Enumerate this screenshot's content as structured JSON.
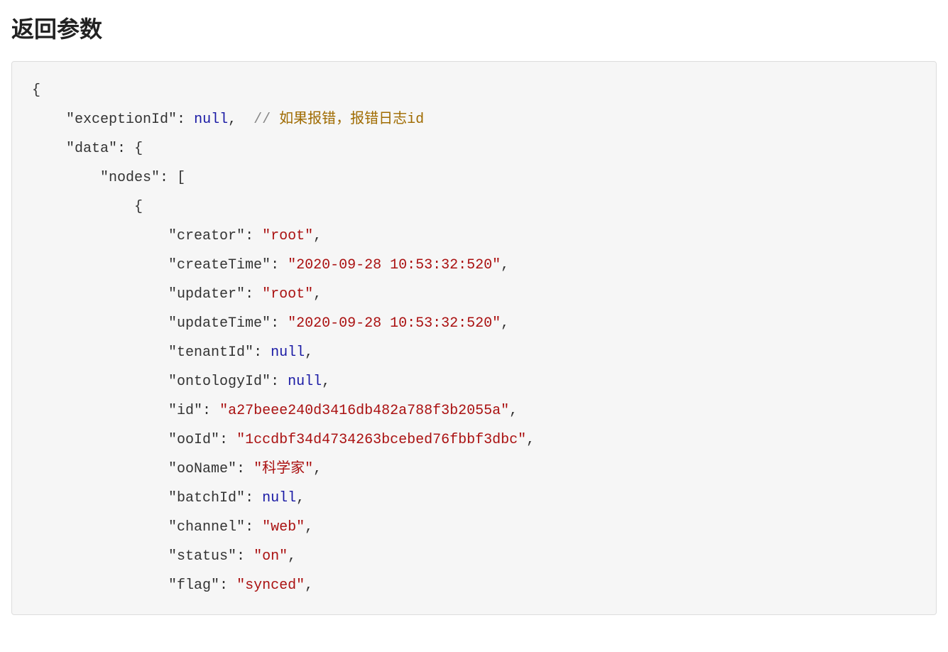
{
  "heading": "返回参数",
  "comment_slashes": "//",
  "comment_text": "如果报错，报错日志id",
  "code": {
    "lines": [
      {
        "indent": 0,
        "type": "open",
        "text": "{"
      },
      {
        "indent": 1,
        "type": "kv-null",
        "key": "exceptionId",
        "comment": true,
        "comma": true
      },
      {
        "indent": 1,
        "type": "kv-open",
        "key": "data",
        "open": "{"
      },
      {
        "indent": 2,
        "type": "kv-open",
        "key": "nodes",
        "open": "["
      },
      {
        "indent": 3,
        "type": "open",
        "text": "{"
      },
      {
        "indent": 4,
        "type": "kv-str",
        "key": "creator",
        "val": "root",
        "comma": true
      },
      {
        "indent": 4,
        "type": "kv-str",
        "key": "createTime",
        "val": "2020-09-28 10:53:32:520",
        "comma": true
      },
      {
        "indent": 4,
        "type": "kv-str",
        "key": "updater",
        "val": "root",
        "comma": true
      },
      {
        "indent": 4,
        "type": "kv-str",
        "key": "updateTime",
        "val": "2020-09-28 10:53:32:520",
        "comma": true
      },
      {
        "indent": 4,
        "type": "kv-null",
        "key": "tenantId",
        "comma": true
      },
      {
        "indent": 4,
        "type": "kv-null",
        "key": "ontologyId",
        "comma": true
      },
      {
        "indent": 4,
        "type": "kv-str",
        "key": "id",
        "val": "a27beee240d3416db482a788f3b2055a",
        "comma": true
      },
      {
        "indent": 4,
        "type": "kv-str",
        "key": "ooId",
        "val": "1ccdbf34d4734263bcebed76fbbf3dbc",
        "comma": true
      },
      {
        "indent": 4,
        "type": "kv-str",
        "key": "ooName",
        "val": "科学家",
        "comma": true
      },
      {
        "indent": 4,
        "type": "kv-null",
        "key": "batchId",
        "comma": true
      },
      {
        "indent": 4,
        "type": "kv-str",
        "key": "channel",
        "val": "web",
        "comma": true
      },
      {
        "indent": 4,
        "type": "kv-str",
        "key": "status",
        "val": "on",
        "comma": true
      },
      {
        "indent": 4,
        "type": "kv-str",
        "key": "flag",
        "val": "synced",
        "comma": true
      }
    ]
  }
}
